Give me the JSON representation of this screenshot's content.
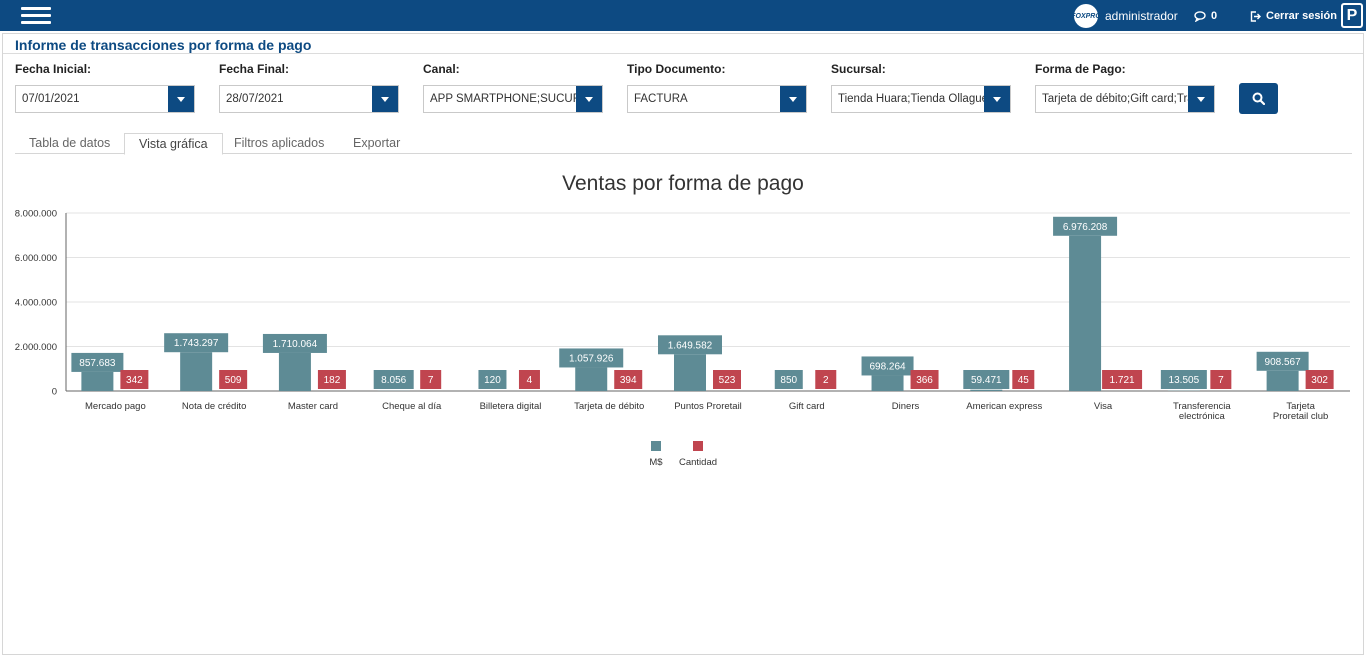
{
  "header": {
    "avatar_text": "FOXPRO",
    "username": "administrador",
    "messages_count": "0",
    "logout_label": "Cerrar sesión",
    "brand_letter": "P"
  },
  "page": {
    "title": "Informe de transacciones por forma de pago"
  },
  "filters": [
    {
      "label": "Fecha Inicial:",
      "value": "07/01/2021"
    },
    {
      "label": "Fecha Final:",
      "value": "28/07/2021"
    },
    {
      "label": "Canal:",
      "value": "APP SMARTPHONE;SUCURSAL"
    },
    {
      "label": "Tipo Documento:",
      "value": "FACTURA"
    },
    {
      "label": "Sucursal:",
      "value": "Tienda Huara;Tienda Ollague;"
    },
    {
      "label": "Forma de Pago:",
      "value": "Tarjeta de débito;Gift card;Transferencia"
    }
  ],
  "tabs": [
    "Tabla de datos",
    "Vista gráfica",
    "Filtros aplicados",
    "Exportar"
  ],
  "active_tab": "Vista gráfica",
  "colors": {
    "navy": "#0d4a82",
    "series_ms": "#5e8b95",
    "series_cantidad": "#c0454f"
  },
  "chart_data": {
    "type": "bar",
    "title": "Ventas por forma de pago",
    "ylim": [
      0,
      8000000
    ],
    "y_ticks": [
      "0",
      "2.000.000",
      "4.000.000",
      "6.000.000",
      "8.000.000"
    ],
    "y_tick_values": [
      0,
      2000000,
      4000000,
      6000000,
      8000000
    ],
    "categories": [
      "Mercado pago",
      "Nota de crédito",
      "Master card",
      "Cheque al día",
      "Billetera digital",
      "Tarjeta de débito",
      "Puntos Proretail",
      "Gift card",
      "Diners",
      "American express",
      "Visa",
      "Transferencia electrónica",
      "Tarjeta Proretail club"
    ],
    "series": [
      {
        "name": "M$",
        "values": [
          857683,
          1743297,
          1710064,
          8056,
          120,
          1057926,
          1649582,
          850,
          698264,
          59471,
          6976208,
          13505,
          908567
        ],
        "labels": [
          "857.683",
          "1.743.297",
          "1.710.064",
          "8.056",
          "120",
          "1.057.926",
          "1.649.582",
          "850",
          "698.264",
          "59.471",
          "6.976.208",
          "13.505",
          "908.567"
        ]
      },
      {
        "name": "Cantidad",
        "values": [
          342,
          509,
          182,
          7,
          4,
          394,
          523,
          2,
          366,
          45,
          1721,
          7,
          302
        ],
        "labels": [
          "342",
          "509",
          "182",
          "7",
          "4",
          "394",
          "523",
          "2",
          "366",
          "45",
          "1.721",
          "7",
          "302"
        ]
      }
    ],
    "legend": "bottom-center",
    "grid": true
  }
}
